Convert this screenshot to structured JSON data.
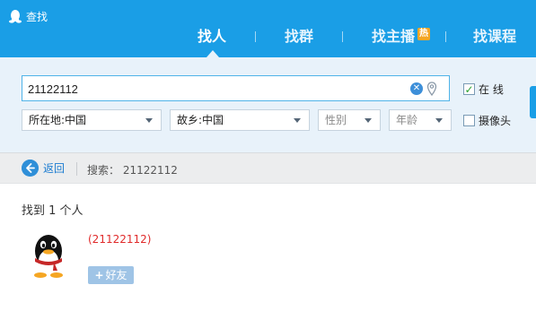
{
  "app": {
    "title": "查找",
    "logo_icon": "qq-penguin-icon"
  },
  "tabs": [
    {
      "label": "找人",
      "active": true
    },
    {
      "label": "找群",
      "active": false
    },
    {
      "label": "找主播",
      "active": false,
      "badge": "热"
    },
    {
      "label": "找课程",
      "active": false
    }
  ],
  "search": {
    "value": "21122112",
    "clear_icon": "clear-icon",
    "location_icon": "location-pin-icon",
    "online": {
      "label": "在  线",
      "checked": true
    },
    "camera": {
      "label": "摄像头",
      "checked": false
    }
  },
  "filters": {
    "location": "所在地:中国",
    "hometown": "故乡:中国",
    "gender": "性别",
    "age": "年龄"
  },
  "nav": {
    "back_label": "返回",
    "search_label": "搜索：",
    "search_value": "21122112"
  },
  "results": {
    "summary": "找到 1 个人",
    "items": [
      {
        "id": "(21122112)",
        "add_label": "好友",
        "add_prefix": "+"
      }
    ]
  },
  "colors": {
    "accent": "#1a9ee6",
    "id_red": "#e02a2a",
    "link_blue": "#1a7bd0"
  }
}
